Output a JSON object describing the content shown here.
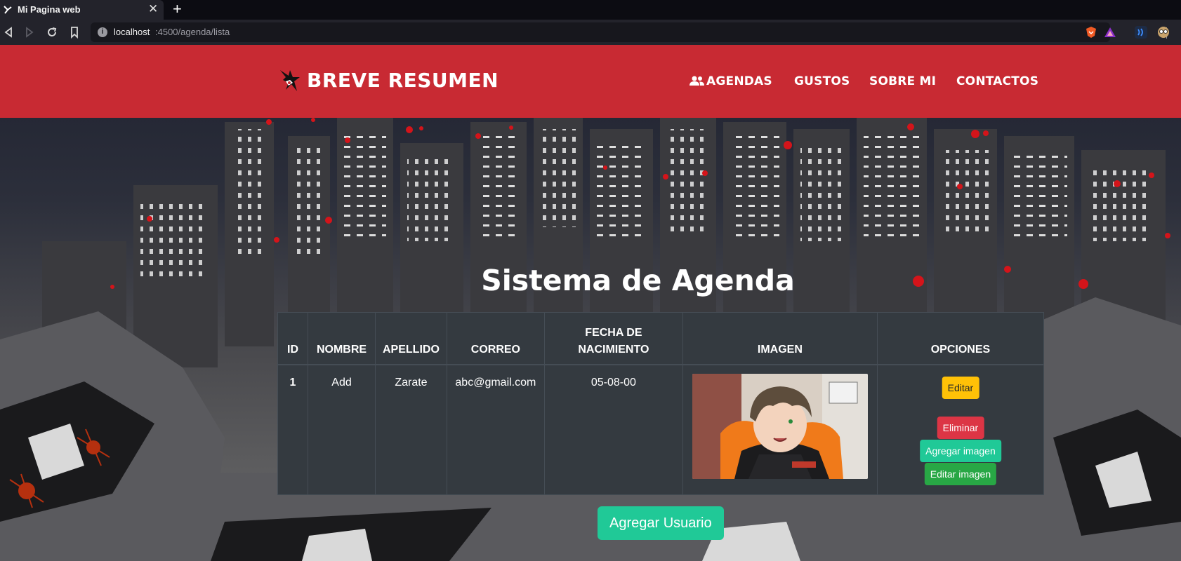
{
  "browser": {
    "tab_title": "Mi Pagina web",
    "tab_close": "✕",
    "new_tab": "+",
    "url_host": "localhost",
    "url_path": ":4500/agenda/lista"
  },
  "navbar": {
    "brand": "BREVE RESUMEN",
    "links": [
      "AGENDAS",
      "GUSTOS",
      "SOBRE MI",
      "CONTACTOS"
    ],
    "color": "#c82a33"
  },
  "main": {
    "heading": "Sistema de Agenda",
    "table": {
      "headers": [
        "ID",
        "NOMBRE",
        "APELLIDO",
        "CORREO",
        "FECHA DE NACIMIENTO",
        "IMAGEN",
        "OPCIONES"
      ],
      "rows": [
        {
          "id": "1",
          "nombre": "Add",
          "apellido": "Zarate",
          "correo": "abc@gmail.com",
          "fecha": "05-08-00"
        }
      ]
    },
    "options": {
      "edit": "Editar",
      "delete": "Eliminar",
      "add_image": "Agregar imagen",
      "edit_image": "Editar imagen"
    },
    "add_user": "Agregar Usuario"
  },
  "colors": {
    "warning": "#ffc107",
    "danger": "#dc3545",
    "teal": "#20c997",
    "success": "#28a745",
    "table_dark": "#343a40"
  },
  "icons": [
    "back-icon",
    "forward-icon",
    "reload-icon",
    "bookmark-icon",
    "info-icon",
    "brave-shield-icon",
    "brave-rewards-icon",
    "users-icon",
    "brand-mask-icon"
  ]
}
